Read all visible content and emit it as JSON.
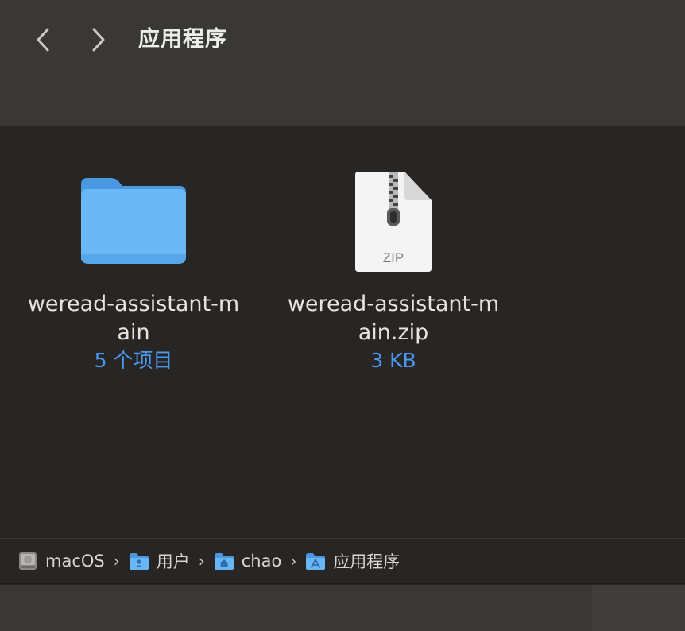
{
  "window": {
    "title": "应用程序"
  },
  "files": [
    {
      "name": "weread-assistant-main",
      "meta": "5 个项目",
      "kind": "folder"
    },
    {
      "name": "weread-assistant-main.zip",
      "meta": "3 KB",
      "kind": "zip",
      "badge": "ZIP"
    }
  ],
  "pathbar": [
    {
      "label": "macOS",
      "icon": "hard-drive-icon"
    },
    {
      "label": "用户",
      "icon": "users-folder-icon"
    },
    {
      "label": "chao",
      "icon": "home-folder-icon"
    },
    {
      "label": "应用程序",
      "icon": "applications-folder-icon"
    }
  ],
  "colors": {
    "accent": "#4b97f1",
    "folder": "#64b3f4"
  }
}
